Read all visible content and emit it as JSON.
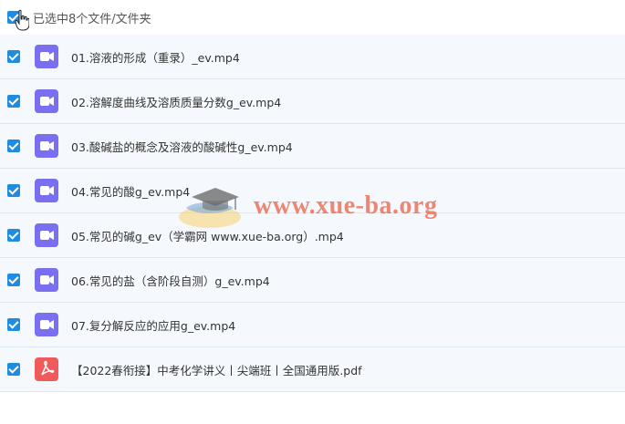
{
  "header": {
    "selection_text": "已选中8个文件/文件夹"
  },
  "files": [
    {
      "name": "01.溶液的形成（重录）_ev.mp4",
      "type": "video"
    },
    {
      "name": "02.溶解度曲线及溶质质量分数g_ev.mp4",
      "type": "video"
    },
    {
      "name": "03.酸碱盐的概念及溶液的酸碱性g_ev.mp4",
      "type": "video"
    },
    {
      "name": "04.常见的酸g_ev.mp4",
      "type": "video"
    },
    {
      "name": "05.常见的碱g_ev（学霸网 www.xue-ba.org）.mp4",
      "type": "video"
    },
    {
      "name": "06.常见的盐（含阶段自测）g_ev.mp4",
      "type": "video"
    },
    {
      "name": "07.复分解反应的应用g_ev.mp4",
      "type": "video"
    },
    {
      "name": "【2022春衔接】中考化学讲义丨尖端班丨全国通用版.pdf",
      "type": "pdf"
    }
  ],
  "watermark": {
    "text": "www.xue-ba.org"
  },
  "colors": {
    "checkbox": "#1f8ce0",
    "video_icon": "#7a6ff0",
    "pdf_icon": "#f05a5a",
    "row_bg": "#f5f9fe"
  }
}
